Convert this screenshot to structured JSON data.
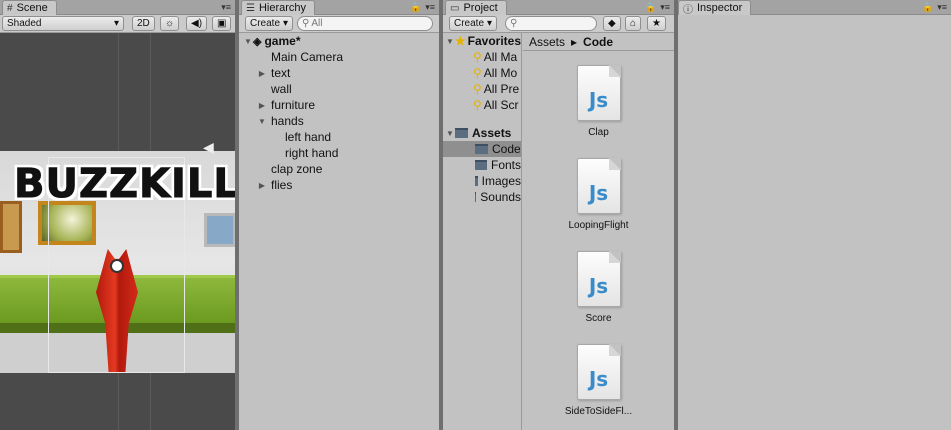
{
  "scene": {
    "tab_label": "Scene",
    "tab_icon": "grid-icon",
    "shading_mode": "Shaded",
    "mode_2d": "2D",
    "game_logo": "BUZZKILL"
  },
  "hierarchy": {
    "tab_label": "Hierarchy",
    "create_label": "Create",
    "search_placeholder": "All",
    "items": [
      {
        "label": "game*",
        "indent": 0,
        "arrow": "down",
        "icon": "unity-icon"
      },
      {
        "label": "Main Camera",
        "indent": 1,
        "arrow": ""
      },
      {
        "label": "text",
        "indent": 1,
        "arrow": "right"
      },
      {
        "label": "wall",
        "indent": 1,
        "arrow": ""
      },
      {
        "label": "furniture",
        "indent": 1,
        "arrow": "right"
      },
      {
        "label": "hands",
        "indent": 1,
        "arrow": "down"
      },
      {
        "label": "left hand",
        "indent": 2,
        "arrow": ""
      },
      {
        "label": "right hand",
        "indent": 2,
        "arrow": ""
      },
      {
        "label": "clap zone",
        "indent": 1,
        "arrow": ""
      },
      {
        "label": "flies",
        "indent": 1,
        "arrow": "right"
      }
    ]
  },
  "project": {
    "tab_label": "Project",
    "create_label": "Create",
    "favorites_label": "Favorites",
    "favorites": [
      "All Ma",
      "All Mo",
      "All Pre",
      "All Scr"
    ],
    "assets_label": "Assets",
    "folders": [
      {
        "label": "Code",
        "selected": true
      },
      {
        "label": "Fonts",
        "selected": false
      },
      {
        "label": "Images",
        "selected": false
      },
      {
        "label": "Sounds",
        "selected": false
      }
    ],
    "breadcrumb": [
      "Assets",
      "Code"
    ],
    "scripts": [
      "Clap",
      "LoopingFlight",
      "Score",
      "SideToSideFl..."
    ],
    "script_icon_text": "Js"
  },
  "inspector": {
    "tab_label": "Inspector"
  }
}
